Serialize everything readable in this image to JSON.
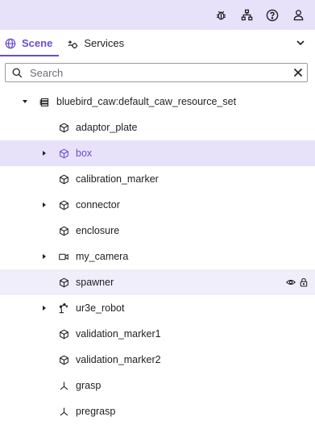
{
  "toolbar": {
    "icons": [
      "bug-icon",
      "sitemap-icon",
      "help-icon",
      "user-icon"
    ]
  },
  "tabs": [
    {
      "label": "Scene",
      "icon": "globe-icon",
      "active": true
    },
    {
      "label": "Services",
      "icon": "services-icon",
      "active": false
    }
  ],
  "search": {
    "placeholder": "Search",
    "value": ""
  },
  "tree": {
    "root": {
      "label": "bluebird_caw:default_caw_resource_set",
      "icon": "layers-icon",
      "expanded": true
    },
    "items": [
      {
        "label": "adaptor_plate",
        "icon": "cube-icon",
        "expandable": false,
        "state": "normal"
      },
      {
        "label": "box",
        "icon": "cube-icon",
        "expandable": true,
        "state": "selected"
      },
      {
        "label": "calibration_marker",
        "icon": "cube-icon",
        "expandable": false,
        "state": "normal"
      },
      {
        "label": "connector",
        "icon": "cube-icon",
        "expandable": true,
        "state": "normal"
      },
      {
        "label": "enclosure",
        "icon": "cube-icon",
        "expandable": false,
        "state": "normal"
      },
      {
        "label": "my_camera",
        "icon": "camera-icon",
        "expandable": true,
        "state": "normal"
      },
      {
        "label": "spawner",
        "icon": "cube-icon",
        "expandable": false,
        "state": "hover"
      },
      {
        "label": "ur3e_robot",
        "icon": "robot-arm-icon",
        "expandable": true,
        "state": "normal"
      },
      {
        "label": "validation_marker1",
        "icon": "cube-icon",
        "expandable": false,
        "state": "normal"
      },
      {
        "label": "validation_marker2",
        "icon": "cube-icon",
        "expandable": false,
        "state": "normal"
      },
      {
        "label": "grasp",
        "icon": "frame-icon",
        "expandable": false,
        "state": "normal"
      },
      {
        "label": "pregrasp",
        "icon": "frame-icon",
        "expandable": false,
        "state": "normal"
      }
    ],
    "hover_actions": [
      "eye-icon",
      "lock-icon"
    ]
  },
  "colors": {
    "accent": "#6b4cd6",
    "header_bg": "#e8e1fa",
    "selected_bg": "#e8e1fa",
    "hover_bg": "#f0eefa"
  }
}
